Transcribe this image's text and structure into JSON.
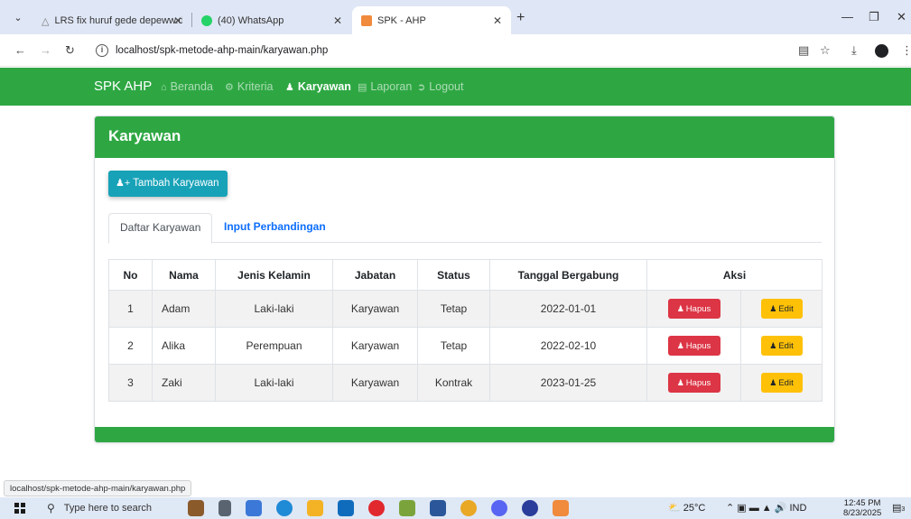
{
  "browser": {
    "tabs": [
      {
        "title": "LRS fix huruf gede depeww.dra",
        "favicon": "drive-icon"
      },
      {
        "title": "(40) WhatsApp",
        "favicon": "whatsapp-icon"
      },
      {
        "title": "SPK - AHP",
        "favicon": "xampp-icon",
        "active": true
      }
    ],
    "url": "localhost/spk-metode-ahp-main/karyawan.php"
  },
  "navbar": {
    "brand": "SPK AHP",
    "items": [
      {
        "label": "Beranda",
        "icon": "home-icon"
      },
      {
        "label": "Kriteria",
        "icon": "cogs-icon"
      },
      {
        "label": "Karyawan",
        "icon": "users-icon",
        "active": true
      },
      {
        "label": "Laporan",
        "icon": "file-icon"
      },
      {
        "label": "Logout",
        "icon": "logout-icon"
      }
    ]
  },
  "card": {
    "title": "Karyawan",
    "add_button": "Tambah Karyawan",
    "tabs": [
      "Daftar Karyawan",
      "Input Perbandingan"
    ]
  },
  "table": {
    "headers": [
      "No",
      "Nama",
      "Jenis Kelamin",
      "Jabatan",
      "Status",
      "Tanggal Bergabung",
      "Aksi"
    ],
    "rows": [
      {
        "no": "1",
        "nama": "Adam",
        "jenis_kelamin": "Laki-laki",
        "jabatan": "Karyawan",
        "status": "Tetap",
        "tanggal": "2022-01-01"
      },
      {
        "no": "2",
        "nama": "Alika",
        "jenis_kelamin": "Perempuan",
        "jabatan": "Karyawan",
        "status": "Tetap",
        "tanggal": "2022-02-10"
      },
      {
        "no": "3",
        "nama": "Zaki",
        "jenis_kelamin": "Laki-laki",
        "jabatan": "Karyawan",
        "status": "Kontrak",
        "tanggal": "2023-01-25"
      }
    ],
    "delete_label": "Hapus",
    "edit_label": "Edit"
  },
  "status_bar_url": "localhost/spk-metode-ahp-main/karyawan.php",
  "taskbar": {
    "search_placeholder": "Type here to search",
    "weather": "25°C",
    "language": "IND",
    "time": "12:45 PM",
    "date": "8/23/2025",
    "notification_count": "3"
  },
  "colors": {
    "primary_green": "#2ea743",
    "info": "#17a2b8",
    "danger": "#dc3545",
    "warning": "#ffc107",
    "link": "#0d6efd"
  }
}
